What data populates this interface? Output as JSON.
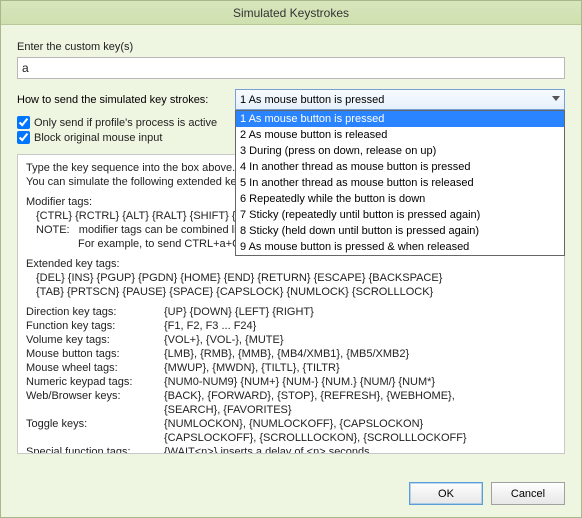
{
  "window": {
    "title": "Simulated Keystrokes"
  },
  "input": {
    "label": "Enter the custom key(s)",
    "value": "a"
  },
  "method": {
    "label": "How to send the simulated key strokes:",
    "selected": "1 As mouse button is pressed",
    "options": [
      "1 As mouse button is pressed",
      "2 As mouse button is released",
      "3 During (press on down, release on up)",
      "4 In another thread as mouse button is pressed",
      "5 In another thread as mouse button is released",
      "6 Repeatedly while the button is down",
      "7 Sticky (repeatedly until button is pressed again)",
      "8 Sticky (held down until button is pressed again)",
      "9 As mouse button is pressed & when released"
    ]
  },
  "checks": {
    "only_if_active": "Only send if profile's process is active",
    "block_mouse": "Block original mouse input"
  },
  "help": {
    "intro1": "Type the key sequence into the box above.",
    "intro2": "You can simulate the following extended keys using the text in braces.",
    "modifier_head": "Modifier tags:",
    "modifier_tags": "{CTRL} {RCTRL} {ALT} {RALT} {SHIFT} {RSHIFT} {WIN} {RWIN} {APPS}",
    "note_label": "NOTE:",
    "note1": "modifier tags can be combined like {CTRL}{ALT} but apply to the NEXT KEY ONLY.",
    "note2": "For example, to send CTRL+a+CTRL+s you should type '{CTRL}A{CTRL}S'.",
    "ext_head": "Extended key tags:",
    "ext1": "{DEL} {INS} {PGUP} {PGDN} {HOME} {END} {RETURN} {ESCAPE} {BACKSPACE}",
    "ext2": "{TAB} {PRTSCN} {PAUSE} {SPACE} {CAPSLOCK} {NUMLOCK} {SCROLLLOCK}",
    "dir_label": "Direction key tags:",
    "dir_val": "{UP} {DOWN} {LEFT} {RIGHT}",
    "func_label": "Function key tags:",
    "func_val": "{F1, F2, F3 ... F24}",
    "vol_label": "Volume key tags:",
    "vol_val": "{VOL+}, {VOL-}, {MUTE}",
    "mbtn_label": "Mouse button tags:",
    "mbtn_val": "{LMB}, {RMB}, {MMB}, {MB4/XMB1}, {MB5/XMB2}",
    "mwheel_label": "Mouse wheel tags:",
    "mwheel_val": "{MWUP}, {MWDN}, {TILTL}, {TILTR}",
    "num_label": "Numeric keypad tags:",
    "num_val": "{NUM0-NUM9} {NUM+} {NUM-} {NUM.} {NUM/} {NUM*}",
    "web_label": "Web/Browser keys:",
    "web_val1": "{BACK}, {FORWARD}, {STOP}, {REFRESH}, {WEBHOME},",
    "web_val2": "{SEARCH}, {FAVORITES}",
    "tog_label": "Toggle keys:",
    "tog_val1": "{NUMLOCKON}, {NUMLOCKOFF}, {CAPSLOCKON}",
    "tog_val2": "{CAPSLOCKOFF}, {SCROLLLOCKON}, {SCROLLLOCKOFF}",
    "sp_label": "Special function tags:",
    "sp_val": "{WAIT<n>} inserts a delay of <n> seconds."
  },
  "buttons": {
    "ok": "OK",
    "cancel": "Cancel"
  }
}
